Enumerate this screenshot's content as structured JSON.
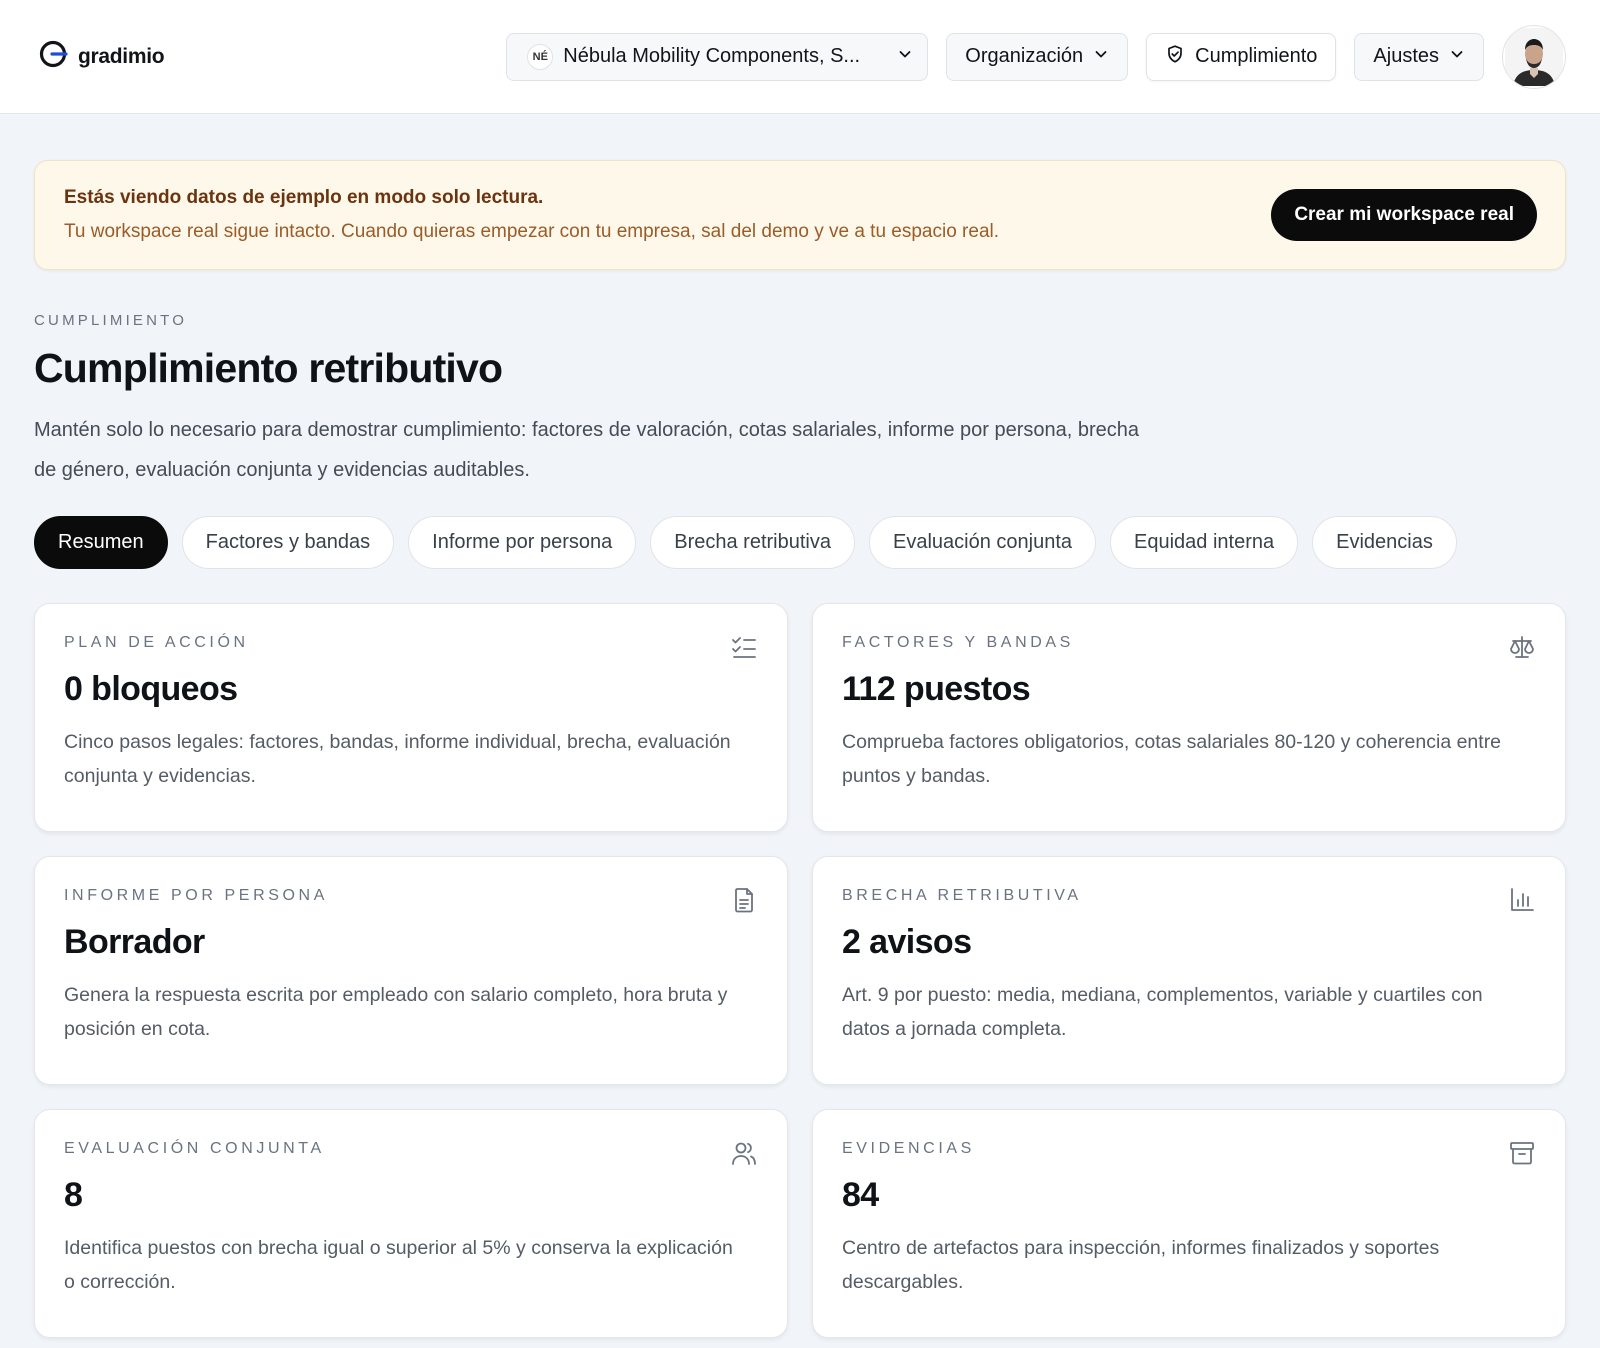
{
  "header": {
    "brand": "gradimio",
    "company": {
      "initials": "NÉ",
      "name": "Nébula Mobility Components, S..."
    },
    "nav": {
      "organizacion": "Organización",
      "cumplimiento": "Cumplimiento",
      "ajustes": "Ajustes"
    },
    "icons": [
      "gradimio-logo-icon",
      "chevron-down-icon",
      "shield-check-icon",
      "avatar"
    ]
  },
  "banner": {
    "title": "Estás viendo datos de ejemplo en modo solo lectura.",
    "subtitle": "Tu workspace real sigue intacto. Cuando quieras empezar con tu empresa, sal del demo y ve a tu espacio real.",
    "cta": "Crear mi workspace real"
  },
  "page": {
    "eyebrow": "CUMPLIMIENTO",
    "title": "Cumplimiento retributivo",
    "description": "Mantén solo lo necesario para demostrar cumplimiento: factores de valoración, cotas salariales, informe por persona, brecha de género, evaluación conjunta y evidencias auditables."
  },
  "tabs": [
    {
      "label": "Resumen",
      "active": true
    },
    {
      "label": "Factores y bandas",
      "active": false
    },
    {
      "label": "Informe por persona",
      "active": false
    },
    {
      "label": "Brecha retributiva",
      "active": false
    },
    {
      "label": "Evaluación conjunta",
      "active": false
    },
    {
      "label": "Equidad interna",
      "active": false
    },
    {
      "label": "Evidencias",
      "active": false
    }
  ],
  "cards": [
    {
      "eyebrow": "PLAN DE ACCIÓN",
      "value": "0 bloqueos",
      "description": "Cinco pasos legales: factores, bandas, informe individual, brecha, evaluación conjunta y evidencias.",
      "icon": "checklist-icon"
    },
    {
      "eyebrow": "FACTORES Y BANDAS",
      "value": "112 puestos",
      "description": "Comprueba factores obligatorios, cotas salariales 80-120 y coherencia entre puntos y bandas.",
      "icon": "scale-icon"
    },
    {
      "eyebrow": "INFORME POR PERSONA",
      "value": "Borrador",
      "description": "Genera la respuesta escrita por empleado con salario completo, hora bruta y posición en cota.",
      "icon": "document-icon"
    },
    {
      "eyebrow": "BRECHA RETRIBUTIVA",
      "value": "2 avisos",
      "description": "Art. 9 por puesto: media, mediana, complementos, variable y cuartiles con datos a jornada completa.",
      "icon": "bar-chart-icon"
    },
    {
      "eyebrow": "EVALUACIÓN CONJUNTA",
      "value": "8",
      "description": "Identifica puestos con brecha igual o superior al 5% y conserva la explicación o corrección.",
      "icon": "users-icon"
    },
    {
      "eyebrow": "EVIDENCIAS",
      "value": "84",
      "description": "Centro de artefactos para inspección, informes finalizados y soportes descargables.",
      "icon": "archive-icon"
    }
  ],
  "colors": {
    "accent": "#1d4ed8",
    "primary_button": "#0b0b0c",
    "banner_bg": "#fdf8e9",
    "banner_title": "#6b3410",
    "banner_text": "#9a5c28",
    "page_bg": "#f1f4f8"
  }
}
